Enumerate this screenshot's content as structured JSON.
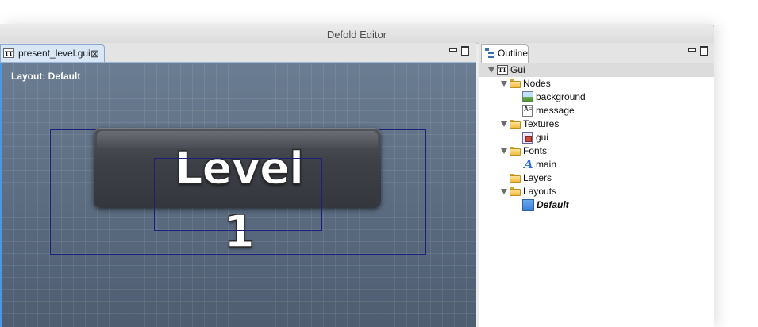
{
  "window": {
    "title": "Defold Editor"
  },
  "editor": {
    "tab_label": "present_level.gui",
    "tab_close": "⊠",
    "tab_icon_text": "TT",
    "layout_label": "Layout: Default",
    "preview_text": "Level 1"
  },
  "outline": {
    "tab_label": "Outline",
    "tree": {
      "root": {
        "label": "Gui",
        "icon_text": "TT"
      },
      "nodes": {
        "label": "Nodes"
      },
      "background": {
        "label": "background"
      },
      "message": {
        "label": "message",
        "icon_text": "A≡"
      },
      "textures": {
        "label": "Textures"
      },
      "gui": {
        "label": "gui"
      },
      "fonts": {
        "label": "Fonts"
      },
      "main": {
        "label": "main",
        "icon_text": "A"
      },
      "layers": {
        "label": "Layers"
      },
      "layouts": {
        "label": "Layouts"
      },
      "default": {
        "label": "Default"
      }
    }
  },
  "colors": {
    "accent": "#4f95e0",
    "node_outline": "#1d1f7a",
    "selection": "#dcdcdc"
  }
}
